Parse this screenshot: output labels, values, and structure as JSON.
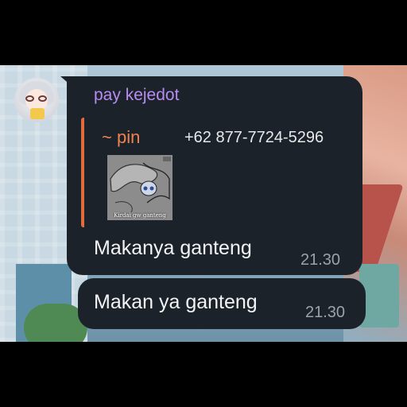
{
  "chat": {
    "messages": [
      {
        "sender": "pay kejedot",
        "reply": {
          "name": "~ pin",
          "phone": "+62 877-7724-5296",
          "thumbnail_caption": "Kirdai gw ganteng"
        },
        "text": "Makanya ganteng",
        "time": "21.30"
      },
      {
        "text": "Makan ya ganteng",
        "time": "21.30"
      }
    ]
  },
  "colors": {
    "bubble": "#1c2229",
    "sender_name": "#b78cf2",
    "reply_accent": "#e26b3c",
    "reply_name": "#ee8351",
    "message_text": "#f2f3f5",
    "timestamp": "#9aa3ad"
  }
}
